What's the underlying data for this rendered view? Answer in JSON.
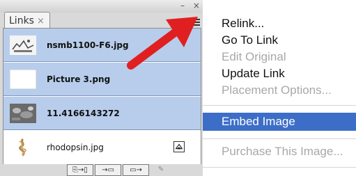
{
  "panel": {
    "tab_label": "Links",
    "tab_close": "×",
    "window_controls": "– ×",
    "rows": [
      {
        "name": "nsmb1100-F6.jpg",
        "selected": true
      },
      {
        "name": "Picture 3.png",
        "selected": true
      },
      {
        "name": "11.4166143272",
        "selected": true
      },
      {
        "name": "rhodopsin.jpg",
        "selected": false
      }
    ],
    "toolbar": {
      "relink": "⎘→▯",
      "goto": "→▭",
      "update": "▭→",
      "edit": "✎"
    }
  },
  "menu": {
    "items": [
      {
        "label": "Relink...",
        "state": "enabled"
      },
      {
        "label": "Go To Link",
        "state": "enabled"
      },
      {
        "label": "Edit Original",
        "state": "disabled"
      },
      {
        "label": "Update Link",
        "state": "enabled"
      },
      {
        "label": "Placement Options...",
        "state": "disabled"
      },
      {
        "label": "Embed Image",
        "state": "highlighted"
      },
      {
        "label": "Purchase This Image...",
        "state": "disabled"
      }
    ]
  },
  "colors": {
    "selection": "#b7cdeb",
    "menu_highlight": "#3d6ec7",
    "arrow": "#e02020"
  }
}
